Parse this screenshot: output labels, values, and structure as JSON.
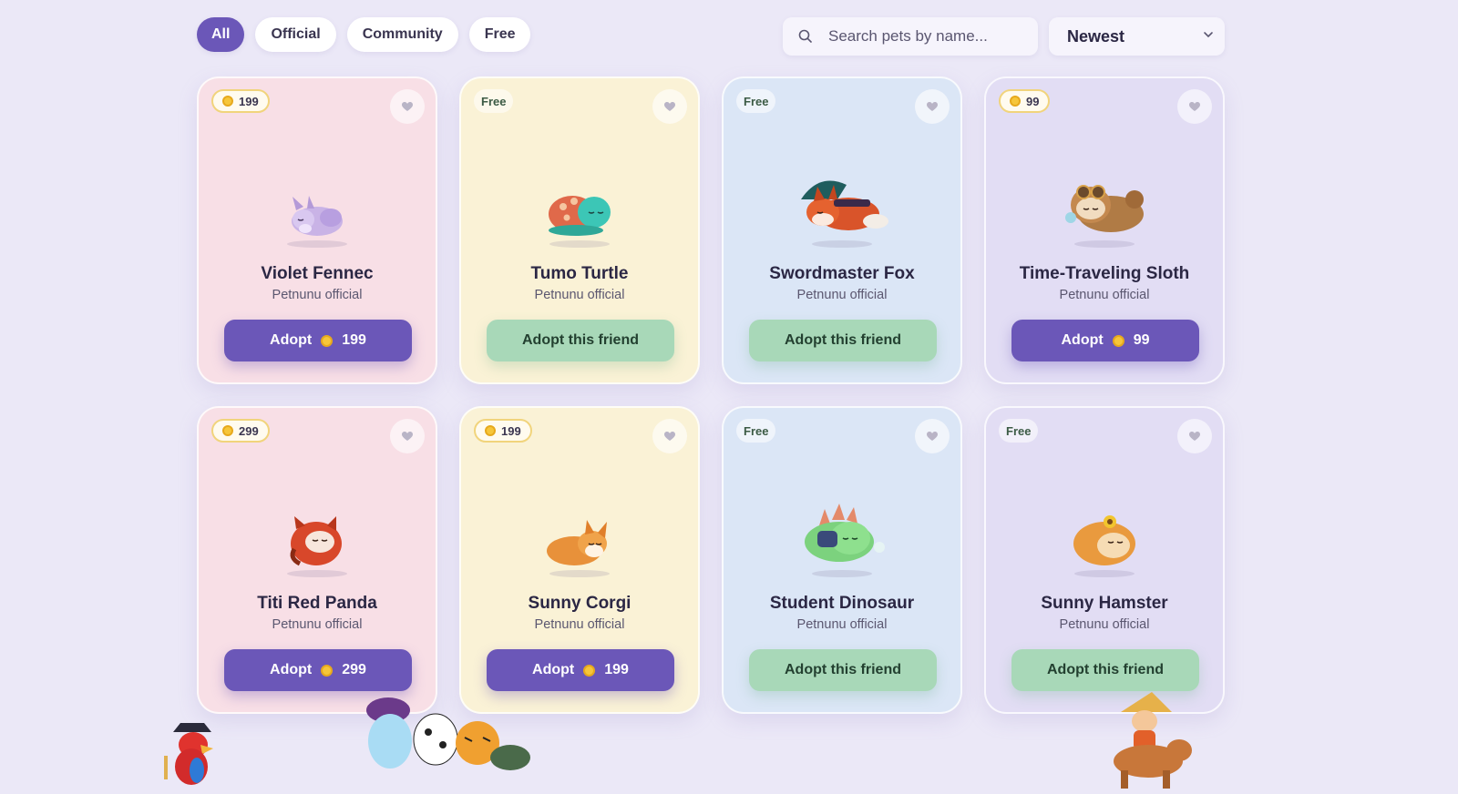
{
  "filters": [
    {
      "label": "All",
      "active": true
    },
    {
      "label": "Official",
      "active": false
    },
    {
      "label": "Community",
      "active": false
    },
    {
      "label": "Free",
      "active": false
    }
  ],
  "search": {
    "placeholder": "Search pets by name..."
  },
  "sort": {
    "value": "Newest"
  },
  "pets": [
    {
      "name": "Violet Fennec",
      "creator": "Petnunu official",
      "badge": "199",
      "price": "199",
      "is_free": false,
      "adopt_label": "Adopt",
      "theme": "pink"
    },
    {
      "name": "Tumo Turtle",
      "creator": "Petnunu official",
      "badge": "Free",
      "is_free": true,
      "adopt_label": "Adopt this friend",
      "theme": "yellow"
    },
    {
      "name": "Swordmaster Fox",
      "creator": "Petnunu official",
      "badge": "Free",
      "is_free": true,
      "adopt_label": "Adopt this friend",
      "theme": "blue"
    },
    {
      "name": "Time-Traveling Sloth",
      "creator": "Petnunu official",
      "badge": "99",
      "price": "99",
      "is_free": false,
      "adopt_label": "Adopt",
      "theme": "lavender"
    },
    {
      "name": "Titi Red Panda",
      "creator": "Petnunu official",
      "badge": "299",
      "price": "299",
      "is_free": false,
      "adopt_label": "Adopt",
      "theme": "pink"
    },
    {
      "name": "Sunny Corgi",
      "creator": "Petnunu official",
      "badge": "199",
      "price": "199",
      "is_free": false,
      "adopt_label": "Adopt",
      "theme": "yellow"
    },
    {
      "name": "Student Dinosaur",
      "creator": "Petnunu official",
      "badge": "Free",
      "is_free": true,
      "adopt_label": "Adopt this friend",
      "theme": "blue"
    },
    {
      "name": "Sunny Hamster",
      "creator": "Petnunu official",
      "badge": "Free",
      "is_free": true,
      "adopt_label": "Adopt this friend",
      "theme": "lavender"
    }
  ],
  "colors": {
    "accent": "#6b57b8",
    "free_button": "#a8d8b8",
    "coin": "#f6c63a",
    "background": "#ebe8f7"
  }
}
